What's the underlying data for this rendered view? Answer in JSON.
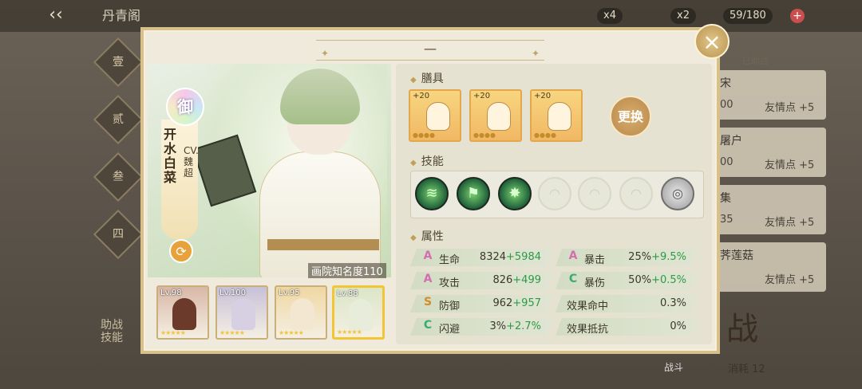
{
  "background": {
    "title": "丹青阁",
    "resources": [
      {
        "value": "x4"
      },
      {
        "value": "x2"
      },
      {
        "value": "59/180"
      }
    ],
    "side_tabs": [
      "壹",
      "贰",
      "叁",
      "四"
    ],
    "left_text": "助战\n技能",
    "right_list_header": "已助战",
    "right_list": [
      {
        "name": "宋",
        "num": "00",
        "bonus": "友情点 +5"
      },
      {
        "name": "屠户",
        "num": "00",
        "bonus": "友情点 +5"
      },
      {
        "name": "集",
        "num": "35",
        "bonus": "友情点 +5"
      },
      {
        "name": "荠莲菇",
        "num": "",
        "bonus": "友情点 +5"
      }
    ],
    "battle": {
      "char": "战",
      "sub": "消耗 12",
      "label": "战斗"
    }
  },
  "panel": {
    "tab_label": "一",
    "close_icon": "×",
    "character": {
      "role_badge": "御",
      "name": "开水白菜",
      "cv": "CV.魏超",
      "fame_label": "画院知名度",
      "fame_value": "110"
    },
    "team": [
      {
        "level": "Lv.98",
        "color": "#d9b7a7",
        "fig": "#6b3a2a",
        "selected": false
      },
      {
        "level": "Lv.100",
        "color": "#c8c0d8",
        "fig": "#d6d0e2",
        "selected": false
      },
      {
        "level": "Lv.95",
        "color": "#f0d7a2",
        "fig": "#f4e7d2",
        "selected": false
      },
      {
        "level": "Lv.88",
        "color": "#dbe6c8",
        "fig": "#e8ecda",
        "selected": true
      }
    ],
    "dishes_title": "膳具",
    "dishes": [
      {
        "plus": "+20",
        "icon": "ladle-chef-icon"
      },
      {
        "plus": "+20",
        "icon": "lantern-chef-icon"
      },
      {
        "plus": "+20",
        "icon": "bowl-chef-icon"
      }
    ],
    "change_button": "更换",
    "skills_title": "技能",
    "skills": [
      {
        "state": "active",
        "icon": "skill-slash-icon",
        "glyph": "≋"
      },
      {
        "state": "active",
        "icon": "skill-flag-icon",
        "glyph": "⚑"
      },
      {
        "state": "active",
        "icon": "skill-burst-icon",
        "glyph": "✸"
      },
      {
        "state": "locked",
        "icon": "fan-lock-icon",
        "glyph": "◠"
      },
      {
        "state": "locked",
        "icon": "fan-lock-icon",
        "glyph": "◠"
      },
      {
        "state": "locked",
        "icon": "fan-lock-icon",
        "glyph": "◠"
      },
      {
        "state": "special",
        "icon": "spiral-skill-icon",
        "glyph": "◎"
      }
    ],
    "attributes_title": "属性",
    "attributes": [
      [
        {
          "grade": "A",
          "label": "生命",
          "base": "8324",
          "bonus": "+5984"
        },
        {
          "grade": "A",
          "label": "暴击",
          "base": "25%",
          "bonus": "+9.5%"
        }
      ],
      [
        {
          "grade": "A",
          "label": "攻击",
          "base": "826",
          "bonus": "+499"
        },
        {
          "grade": "C",
          "label": "暴伤",
          "base": "50%",
          "bonus": "+0.5%"
        }
      ],
      [
        {
          "grade": "S",
          "label": "防御",
          "base": "962",
          "bonus": "+957"
        },
        {
          "grade": "",
          "label": "效果命中",
          "base": "0.3%",
          "bonus": ""
        }
      ],
      [
        {
          "grade": "C",
          "label": "闪避",
          "base": "3%",
          "bonus": "+2.7%"
        },
        {
          "grade": "",
          "label": "效果抵抗",
          "base": "0%",
          "bonus": ""
        }
      ]
    ]
  }
}
